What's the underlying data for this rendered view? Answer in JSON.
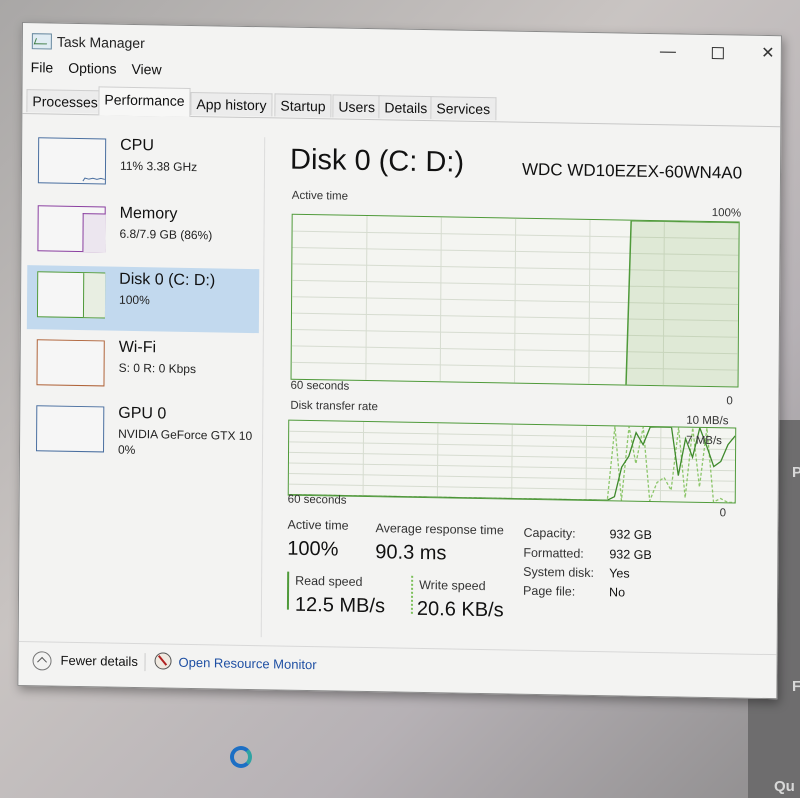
{
  "window": {
    "title": "Task Manager",
    "controls": {
      "minimize": "—",
      "close": "✕"
    }
  },
  "menu": [
    {
      "label": "File"
    },
    {
      "label": "Options"
    },
    {
      "label": "View"
    }
  ],
  "tabs": [
    {
      "label": "Processes",
      "active": false
    },
    {
      "label": "Performance",
      "active": true
    },
    {
      "label": "App history",
      "active": false
    },
    {
      "label": "Startup",
      "active": false
    },
    {
      "label": "Users",
      "active": false
    },
    {
      "label": "Details",
      "active": false
    },
    {
      "label": "Services",
      "active": false
    }
  ],
  "sidebar": {
    "items": [
      {
        "name": "CPU",
        "sub": "11% 3.38 GHz",
        "color": "#4a6fa0",
        "selected": false
      },
      {
        "name": "Memory",
        "sub": "6.8/7.9 GB (86%)",
        "color": "#8a3fa0",
        "selected": false
      },
      {
        "name": "Disk 0 (C: D:)",
        "sub": "100%",
        "color": "#4f9a3a",
        "selected": true
      },
      {
        "name": "Wi-Fi",
        "sub": "S: 0 R: 0 Kbps",
        "color": "#b0643a",
        "selected": false
      },
      {
        "name": "GPU 0",
        "sub": "NVIDIA GeForce GTX 10",
        "sub2": "0%",
        "color": "#4a6fa0",
        "selected": false
      }
    ]
  },
  "main": {
    "title": "Disk 0 (C: D:)",
    "model": "WDC WD10EZEX-60WN4A0",
    "active_time_graph": {
      "label": "Active time",
      "max_label": "100%",
      "time_label": "60 seconds",
      "min_label": "0",
      "active_fraction_recent": 0.25
    },
    "transfer_graph": {
      "label": "Disk transfer rate",
      "max_label": "10 MB/s",
      "mid_label": "7 MB/s",
      "time_label": "60 seconds",
      "min_label": "0",
      "read_series": [
        0,
        0,
        0,
        0,
        0,
        0,
        0,
        0,
        0,
        0,
        0,
        0,
        0,
        0,
        0,
        0,
        0,
        0,
        0,
        0,
        0,
        0,
        0,
        0,
        0,
        0,
        0,
        0,
        0,
        0,
        0,
        0,
        0,
        0,
        0,
        0,
        0,
        0,
        0,
        0,
        0,
        0,
        0,
        0,
        0,
        0,
        0.5,
        4.5,
        6,
        9.2,
        7.6,
        10,
        10,
        10,
        10,
        3.5,
        8.5,
        6,
        10,
        7.5,
        4.8,
        5.5,
        7.8,
        9
      ],
      "write_series": [
        0,
        0,
        0,
        0,
        0,
        0,
        0,
        0,
        0,
        0,
        0,
        0,
        0,
        0,
        0,
        0,
        0,
        0,
        0,
        0,
        0,
        0,
        0,
        0,
        0,
        0,
        0,
        0,
        0,
        0,
        0,
        0,
        0,
        0,
        0,
        0,
        0,
        0,
        0,
        0,
        0,
        0,
        0,
        0,
        0,
        0,
        10,
        0,
        10,
        5,
        10,
        0,
        2.5,
        3.2,
        1.5,
        10,
        0.5,
        10,
        2,
        10,
        0,
        0.5,
        0,
        0
      ]
    },
    "stats": {
      "active_time_label": "Active time",
      "active_time_value": "100%",
      "avg_response_label": "Average response time",
      "avg_response_value": "90.3 ms",
      "read_speed_label": "Read speed",
      "read_speed_value": "12.5 MB/s",
      "write_speed_label": "Write speed",
      "write_speed_value": "20.6 KB/s"
    },
    "properties": [
      {
        "key": "Capacity:",
        "value": "932 GB"
      },
      {
        "key": "Formatted:",
        "value": "932 GB"
      },
      {
        "key": "System disk:",
        "value": "Yes"
      },
      {
        "key": "Page file:",
        "value": "No"
      }
    ]
  },
  "footer": {
    "fewer_details": "Fewer details",
    "open_resource_monitor": "Open Resource Monitor"
  },
  "desktop": {
    "right_letters": [
      "P",
      "F",
      "Qu"
    ]
  }
}
